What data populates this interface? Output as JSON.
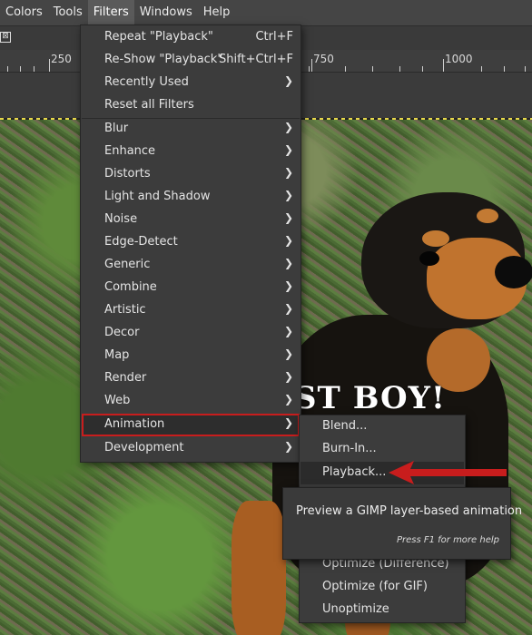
{
  "menubar": {
    "items": [
      "Colors",
      "Tools",
      "Filters",
      "Windows",
      "Help"
    ]
  },
  "toolbar": {
    "close_glyph": "⊠"
  },
  "ruler": {
    "labels": [
      "250",
      "750",
      "1000"
    ]
  },
  "canvas": {
    "overlay_text": "ST BOY!"
  },
  "filters_menu": {
    "top_items": [
      {
        "label": "Repeat \"Playback\"",
        "shortcut": "Ctrl+F"
      },
      {
        "label": "Re-Show \"Playback\"",
        "shortcut": "Shift+Ctrl+F"
      },
      {
        "label": "Recently Used",
        "submenu": true
      },
      {
        "label": "Reset all Filters"
      }
    ],
    "categories": [
      "Blur",
      "Enhance",
      "Distorts",
      "Light and Shadow",
      "Noise",
      "Edge-Detect",
      "Generic",
      "Combine",
      "Artistic",
      "Decor",
      "Map",
      "Render",
      "Web",
      "Animation",
      "Development"
    ],
    "highlighted": "Animation"
  },
  "animation_submenu": {
    "items": [
      "Blend...",
      "Burn-In...",
      "Playback...",
      "Optimize (Difference)",
      "Optimize (for GIF)",
      "Unoptimize"
    ],
    "hovered": "Playback..."
  },
  "tooltip": {
    "text": "Preview a GIMP layer-based animation",
    "help": "Press F1 for more help"
  },
  "colors": {
    "highlight_border": "#c81d1d",
    "arrow": "#c81d1d",
    "menu_bg": "#3c3c3c"
  },
  "icons": {
    "submenu_arrow": "chevron-right-icon",
    "annotation_arrow": "red-arrow-left-icon"
  }
}
